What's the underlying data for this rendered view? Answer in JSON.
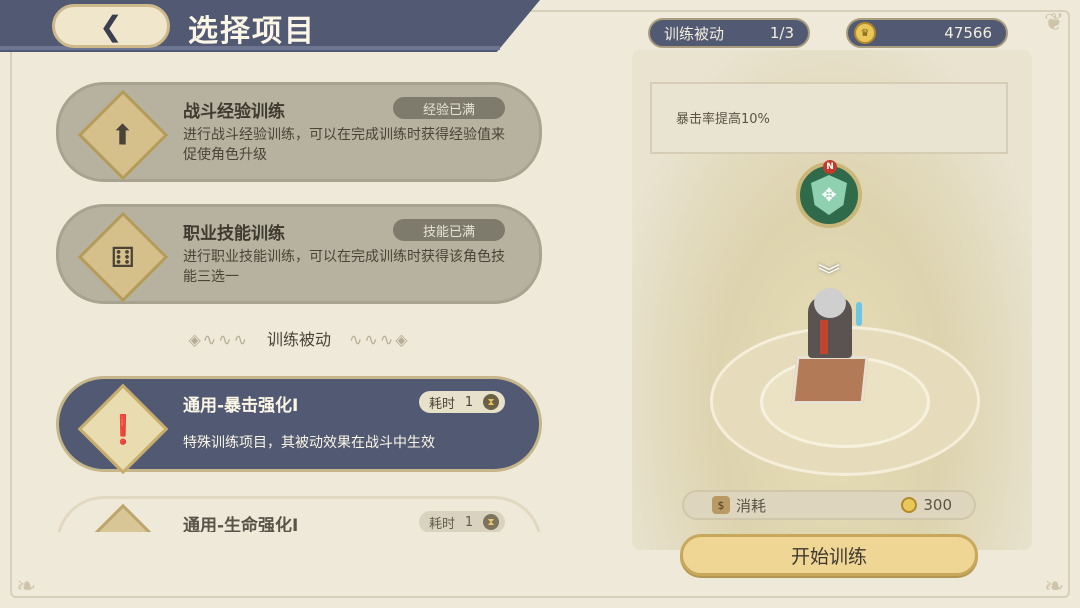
{
  "header": {
    "title": "选择项目",
    "back_icon": "back-arrow-icon"
  },
  "top": {
    "training_label": "训练被动",
    "training_count": "1/3",
    "gold": "47566"
  },
  "cards": [
    {
      "title": "战斗经验训练",
      "status": "经验已满",
      "desc": "进行战斗经验训练，可以在完成训练时获得经验值来促使角色升级",
      "icon": "level-up-icon"
    },
    {
      "title": "职业技能训练",
      "status": "技能已满",
      "desc": "进行职业技能训练，可以在完成训练时获得该角色技能三选一",
      "icon": "dice-icon"
    }
  ],
  "section_title": "训练被动",
  "passive_cards": [
    {
      "title": "通用-暴击强化I",
      "time_label": "耗时",
      "time_value": "1",
      "desc": "特殊训练项目，其被动效果在战斗中生效",
      "icon": "atom-exclaim-icon"
    },
    {
      "title": "通用-生命强化I",
      "time_label": "耗时",
      "time_value": "1",
      "icon": "atom-icon"
    }
  ],
  "right_panel": {
    "buff_text": "暴击率提高10%",
    "shield_badge": "N",
    "cost_label": "消耗",
    "cost_value": "300",
    "start_button": "开始训练"
  },
  "colors": {
    "navy": "#525972",
    "gold": "#efd695",
    "parchment": "#efe9da"
  }
}
